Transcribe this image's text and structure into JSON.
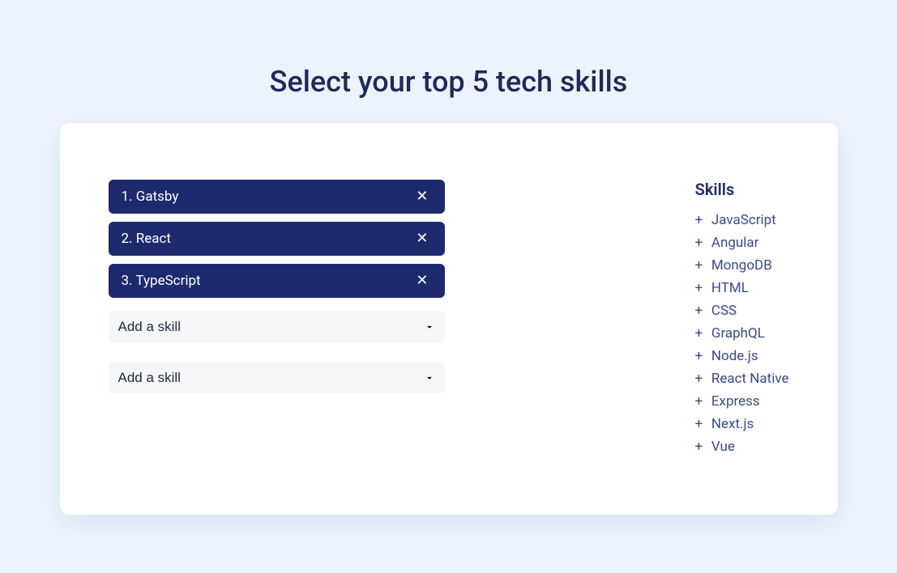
{
  "title": "Select your top 5 tech skills",
  "selected_skills": [
    {
      "index": "1.",
      "name": "Gatsby"
    },
    {
      "index": "2.",
      "name": "React"
    },
    {
      "index": "3.",
      "name": "TypeScript"
    }
  ],
  "empty_slots": [
    {
      "placeholder": "Add a skill"
    },
    {
      "placeholder": "Add a skill"
    }
  ],
  "skills_heading": "Skills",
  "plus_symbol": "+",
  "remove_symbol": "✕",
  "available_skills": [
    "JavaScript",
    "Angular",
    "MongoDB",
    "HTML",
    "CSS",
    "GraphQL",
    "Node.js",
    "React Native",
    "Express",
    "Next.js",
    "Vue"
  ]
}
